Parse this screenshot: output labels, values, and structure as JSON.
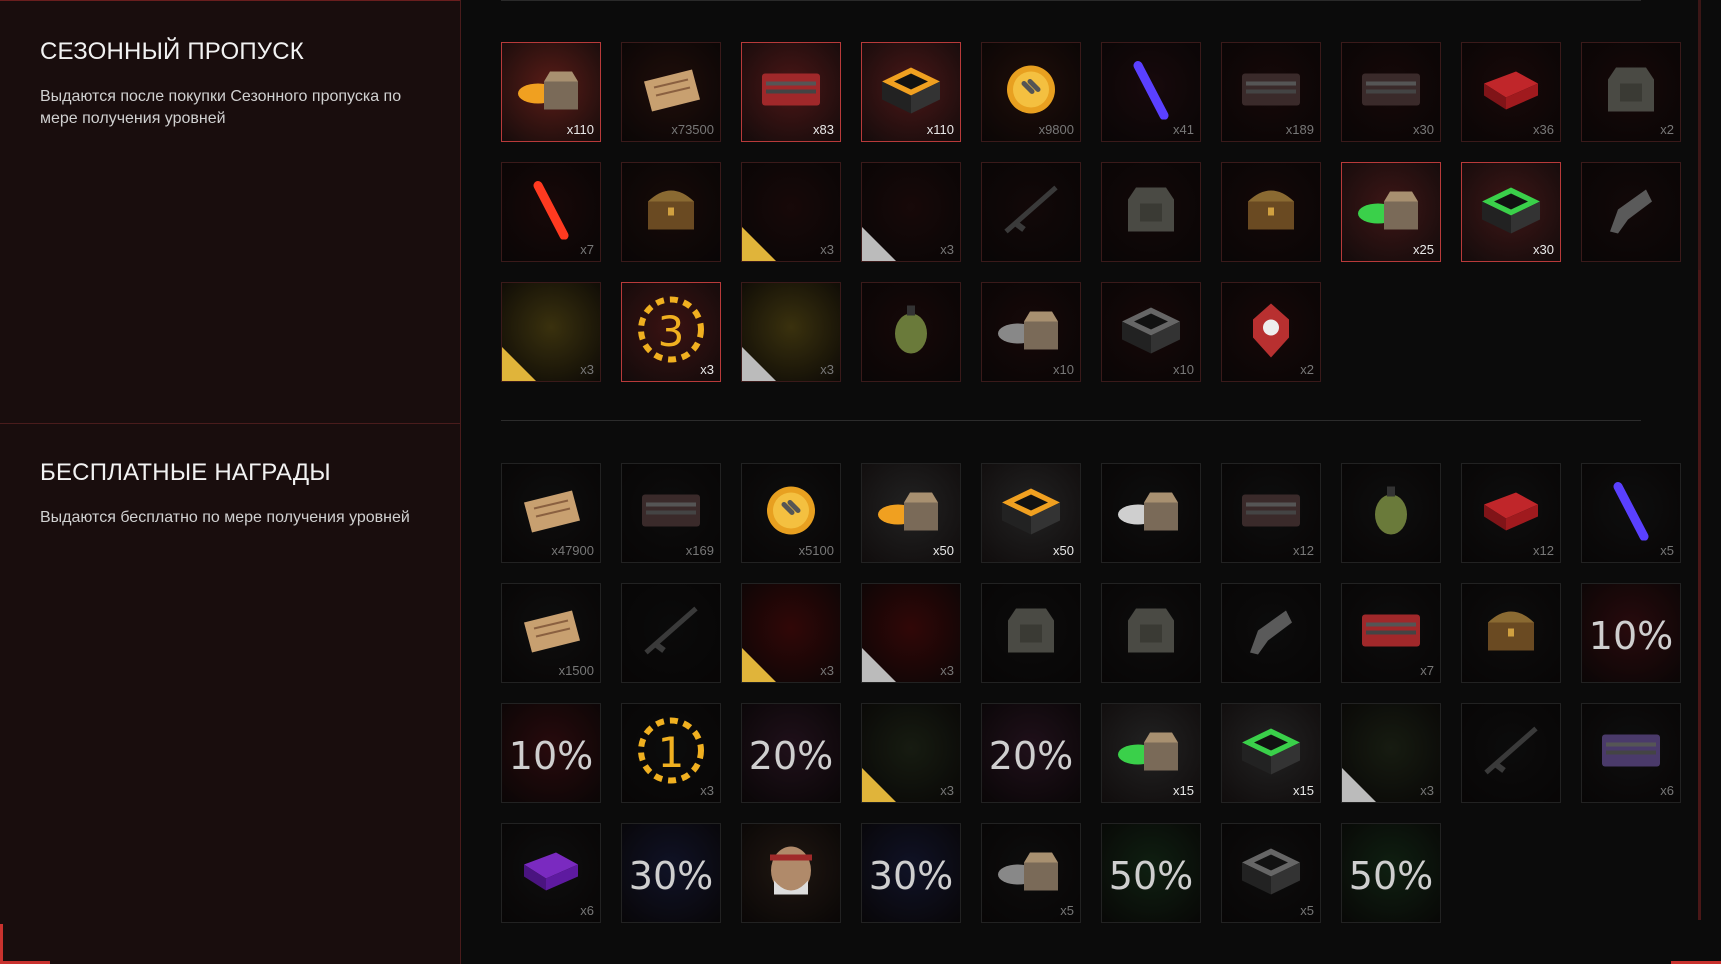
{
  "season_pass": {
    "title": "СЕЗОННЫЙ ПРОПУСК",
    "description": "Выдаются после покупки Сезонного пропуска по мере получения уровней",
    "items": [
      {
        "icon": "orange-crate-icon",
        "qty": "x110",
        "state": "bright",
        "bg": "#5a1c17"
      },
      {
        "icon": "map-scroll-icon",
        "qty": "x73500",
        "state": "dim",
        "bg": "#3b1a14"
      },
      {
        "icon": "red-case-icon",
        "qty": "x83",
        "state": "bright",
        "bg": "#4b1616"
      },
      {
        "icon": "orange-box-icon",
        "qty": "x110",
        "state": "bright",
        "bg": "#4a1717"
      },
      {
        "icon": "gold-coin-icon",
        "qty": "x9800",
        "state": "dim",
        "bg": "#3a1a12"
      },
      {
        "icon": "blue-glowstick-icon",
        "qty": "x41",
        "state": "dim",
        "bg": "#2c1216"
      },
      {
        "icon": "dark-case-icon",
        "qty": "x189",
        "state": "dim",
        "bg": "#2a1010"
      },
      {
        "icon": "weapon-case-icon",
        "qty": "x30",
        "state": "dim",
        "bg": "#2a1010"
      },
      {
        "icon": "red-box-icon",
        "qty": "x36",
        "state": "dim",
        "bg": "#2f1111"
      },
      {
        "icon": "helmet-icon",
        "qty": "x2",
        "state": "dim",
        "bg": "#2a1010"
      },
      {
        "icon": "red-glowstick-icon",
        "qty": "x7",
        "state": "dim",
        "bg": "#2c1010"
      },
      {
        "icon": "treasure-chest-icon",
        "qty": "",
        "state": "dim",
        "bg": "#2a1410"
      },
      {
        "icon": "chain-weapon-skin-icon",
        "qty": "x3",
        "state": "dim",
        "bg": "#2b1111",
        "tag": "gold"
      },
      {
        "icon": "chain-armor-skin-icon",
        "qty": "x3",
        "state": "dim",
        "bg": "#2b1111",
        "tag": "grey"
      },
      {
        "icon": "rifle-icon",
        "qty": "",
        "state": "dim",
        "bg": "#221010"
      },
      {
        "icon": "armor-vest-icon",
        "qty": "",
        "state": "dim",
        "bg": "#241010"
      },
      {
        "icon": "ornate-chest-icon",
        "qty": "",
        "state": "dim",
        "bg": "#261010"
      },
      {
        "icon": "green-crate-icon",
        "qty": "x25",
        "state": "bright",
        "bg": "#3e1616"
      },
      {
        "icon": "green-box-icon",
        "qty": "x30",
        "state": "bright",
        "bg": "#3e1616"
      },
      {
        "icon": "revolver-icon",
        "qty": "",
        "state": "dim",
        "bg": "#221010"
      },
      {
        "icon": "gold-weapon-skin-icon",
        "qty": "x3",
        "state": "dim",
        "bg": "#6a5a1a",
        "tag": "gold"
      },
      {
        "icon": "laurel-badge-3-icon",
        "qty": "x3",
        "state": "bright",
        "bg": "#3a1212",
        "badge": "3"
      },
      {
        "icon": "gold-armor-skin-icon",
        "qty": "x3",
        "state": "dim",
        "bg": "#6a5a1a",
        "tag": "grey"
      },
      {
        "icon": "grenade-icon",
        "qty": "",
        "state": "dim",
        "bg": "#2a1010"
      },
      {
        "icon": "grey-crate-icon",
        "qty": "x10",
        "state": "dim",
        "bg": "#2a1010"
      },
      {
        "icon": "black-box-icon",
        "qty": "x10",
        "state": "dim",
        "bg": "#2a1010"
      },
      {
        "icon": "radiation-shield-icon",
        "qty": "x2",
        "state": "dim",
        "bg": "#2a1010"
      }
    ]
  },
  "free_rewards": {
    "title": "БЕСПЛАТНЫЕ НАГРАДЫ",
    "description": "Выдаются бесплатно по мере получения уровней",
    "items": [
      {
        "icon": "map-scroll-icon",
        "qty": "x47900",
        "state": "dim",
        "bg": "#1a1a1a"
      },
      {
        "icon": "dark-case-icon",
        "qty": "x169",
        "state": "dim",
        "bg": "#171717"
      },
      {
        "icon": "gold-coin-icon",
        "qty": "x5100",
        "state": "dim",
        "bg": "#1a1a1a"
      },
      {
        "icon": "orange-crate-icon",
        "qty": "x50",
        "state": "brightw",
        "bg": "#222"
      },
      {
        "icon": "orange-box-icon",
        "qty": "x50",
        "state": "brightw",
        "bg": "#222"
      },
      {
        "icon": "white-crate-icon",
        "qty": "",
        "state": "dim",
        "bg": "#1a1a1a"
      },
      {
        "icon": "weapon-case-icon",
        "qty": "x12",
        "state": "dim",
        "bg": "#1a1a1a"
      },
      {
        "icon": "grenade-icon",
        "qty": "",
        "state": "dim",
        "bg": "#1a1a1a"
      },
      {
        "icon": "red-box-icon",
        "qty": "x12",
        "state": "dim",
        "bg": "#1a1a1a"
      },
      {
        "icon": "blue-glowstick-icon",
        "qty": "x5",
        "state": "dim",
        "bg": "#1a1a1a"
      },
      {
        "icon": "document-icon",
        "qty": "x1500",
        "state": "dim",
        "bg": "#1a1a1a"
      },
      {
        "icon": "sniper-rifle-icon",
        "qty": "",
        "state": "dim",
        "bg": "#141414"
      },
      {
        "icon": "blood-weapon-skin-icon",
        "qty": "x3",
        "state": "dim",
        "bg": "#5a0e0e",
        "tag": "gold"
      },
      {
        "icon": "blood-armor-skin-icon",
        "qty": "x3",
        "state": "dim",
        "bg": "#5a0e0e",
        "tag": "grey"
      },
      {
        "icon": "backpack-icon",
        "qty": "",
        "state": "dim",
        "bg": "#161616"
      },
      {
        "icon": "armor-vest-icon",
        "qty": "",
        "state": "dim",
        "bg": "#181818"
      },
      {
        "icon": "revolver-icon",
        "qty": "",
        "state": "dim",
        "bg": "#161616"
      },
      {
        "icon": "red-case-icon",
        "qty": "x7",
        "state": "dim",
        "bg": "#181818"
      },
      {
        "icon": "wooden-chest-icon",
        "qty": "",
        "state": "dim",
        "bg": "#181818"
      },
      {
        "icon": "discount-weapon-icon",
        "qty": "",
        "state": "dim",
        "bg": "#4a1418",
        "pct": "10%"
      },
      {
        "icon": "discount-armor-icon",
        "qty": "",
        "state": "dim",
        "bg": "#4a1418",
        "pct": "10%"
      },
      {
        "icon": "laurel-badge-1-icon",
        "qty": "x3",
        "state": "dim",
        "bg": "#161616",
        "badge": "1"
      },
      {
        "icon": "discount-weapon-icon",
        "qty": "",
        "state": "dim",
        "bg": "#3a1e30",
        "pct": "20%"
      },
      {
        "icon": "snake-weapon-skin-icon",
        "qty": "x3",
        "state": "dim",
        "bg": "#2a3320",
        "tag": "gold"
      },
      {
        "icon": "discount-armor-icon",
        "qty": "",
        "state": "dim",
        "bg": "#3a1e30",
        "pct": "20%"
      },
      {
        "icon": "green-crate-icon",
        "qty": "x15",
        "state": "brightw",
        "bg": "#222"
      },
      {
        "icon": "green-box-icon",
        "qty": "x15",
        "state": "brightw",
        "bg": "#222"
      },
      {
        "icon": "snake-armor-skin-icon",
        "qty": "x3",
        "state": "dim",
        "bg": "#2a3320",
        "tag": "grey"
      },
      {
        "icon": "axe-icon",
        "qty": "",
        "state": "dim",
        "bg": "#161616"
      },
      {
        "icon": "purple-weapon-case-icon",
        "qty": "x6",
        "state": "dim",
        "bg": "#1a1a1a"
      },
      {
        "icon": "purple-box-icon",
        "qty": "x6",
        "state": "dim",
        "bg": "#1a1a1a"
      },
      {
        "icon": "discount-weapon-icon",
        "qty": "",
        "state": "dim",
        "bg": "#1e2246",
        "pct": "30%"
      },
      {
        "icon": "character-portrait-icon",
        "qty": "",
        "state": "dim",
        "bg": "#3a2a20"
      },
      {
        "icon": "discount-armor-icon",
        "qty": "",
        "state": "dim",
        "bg": "#1e2246",
        "pct": "30%"
      },
      {
        "icon": "grey-crate-icon",
        "qty": "x5",
        "state": "dim",
        "bg": "#181818"
      },
      {
        "icon": "discount-weapon-icon",
        "qty": "",
        "state": "dim",
        "bg": "#1c3a20",
        "pct": "50%"
      },
      {
        "icon": "black-box-icon",
        "qty": "x5",
        "state": "dim",
        "bg": "#181818"
      },
      {
        "icon": "discount-armor-icon",
        "qty": "",
        "state": "dim",
        "bg": "#1c3a20",
        "pct": "50%"
      }
    ]
  },
  "colors": {
    "accent": "#c8322e",
    "panel": "#190d0d"
  }
}
